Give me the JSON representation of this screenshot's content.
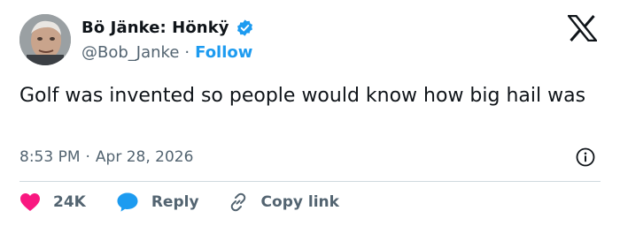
{
  "user": {
    "display_name": "Bö Jänke: Hönkÿ",
    "handle": "@Bob_Janke",
    "follow_label": "Follow",
    "verified": true
  },
  "tweet": {
    "text": "Golf was invented so people would know how big hail was",
    "time": "8:53 PM",
    "date": "Apr 28, 2026"
  },
  "actions": {
    "like_count": "24K",
    "reply_label": "Reply",
    "copy_link_label": "Copy link"
  },
  "colors": {
    "accent": "#1d9bf0",
    "like": "#f91880",
    "text": "#0f1419",
    "secondary": "#536471",
    "divider": "#cfd9de"
  },
  "separator": "·",
  "icons": [
    "avatar",
    "verified-badge-icon",
    "x-logo-icon",
    "info-icon",
    "heart-icon",
    "reply-bubble-icon",
    "link-icon"
  ]
}
